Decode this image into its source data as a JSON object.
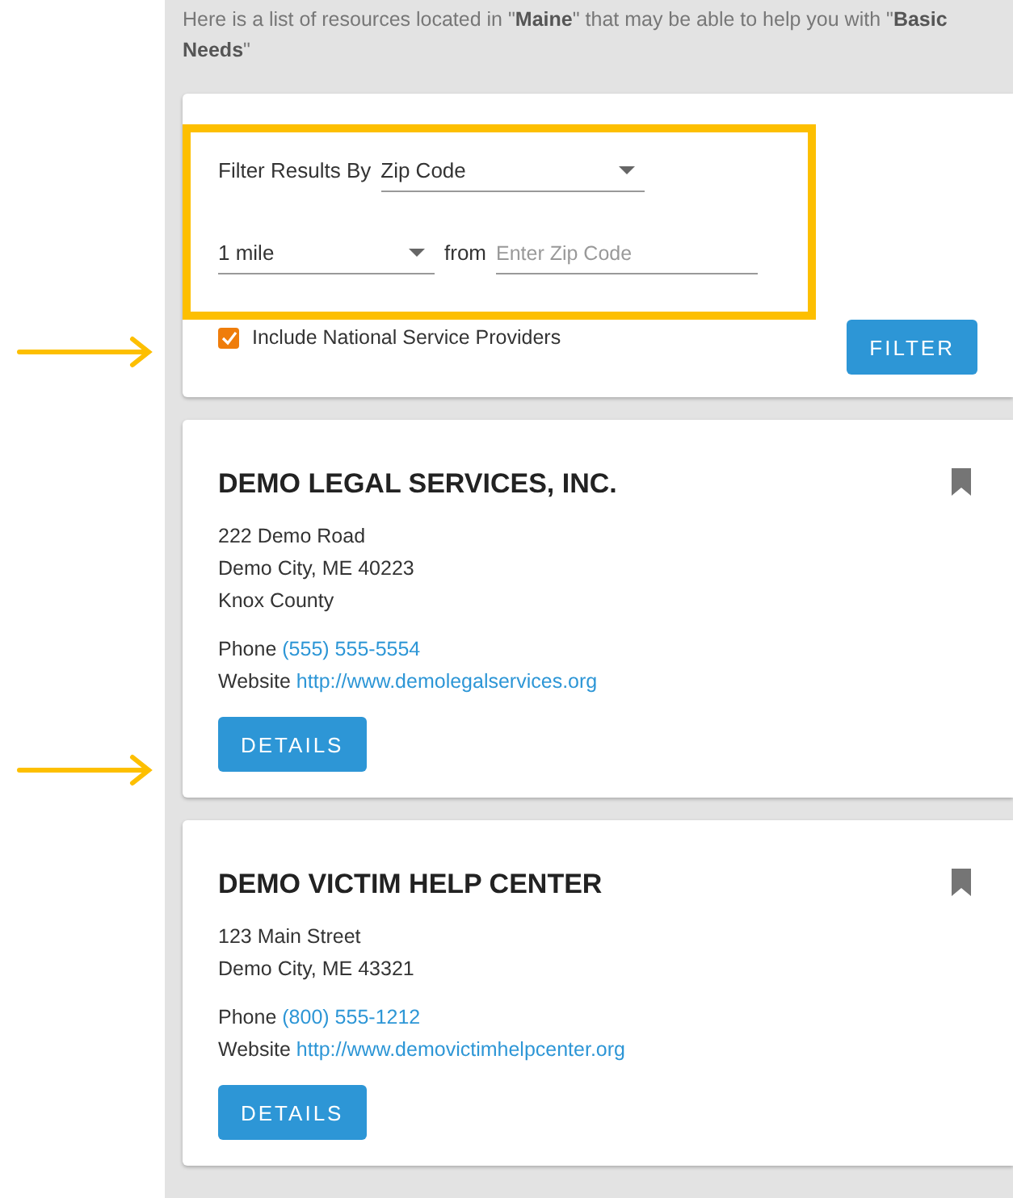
{
  "intro": "Here is a list of resources located in \"**Maine**\" that may be able to help you with \"**Basic Needs**\"",
  "filter": {
    "label": "Filter Results By",
    "filter_by": "Zip Code",
    "distance": "1 mile",
    "from_label": "from",
    "zip": {
      "placeholder": "Enter Zip Code"
    },
    "include_national": {
      "label": "Include National Service Providers",
      "checked": true
    },
    "button": "FILTER"
  },
  "resources": [
    {
      "name": "DEMO LEGAL SERVICES, INC.",
      "address": [
        "222 Demo Road",
        "Demo City, ME 40223",
        "Knox County"
      ],
      "phone_label": "Phone",
      "phone": "(555) 555-5554",
      "website_label": "Website",
      "website": "http://www.demolegalservices.org",
      "button": "DETAILS"
    },
    {
      "name": "DEMO VICTIM HELP CENTER",
      "address": [
        "123 Main Street",
        "Demo City, ME 43321"
      ],
      "phone_label": "Phone",
      "phone": "(800) 555-1212",
      "website_label": "Website",
      "website": "http://www.demovictimhelpcenter.org",
      "button": "DETAILS"
    }
  ]
}
